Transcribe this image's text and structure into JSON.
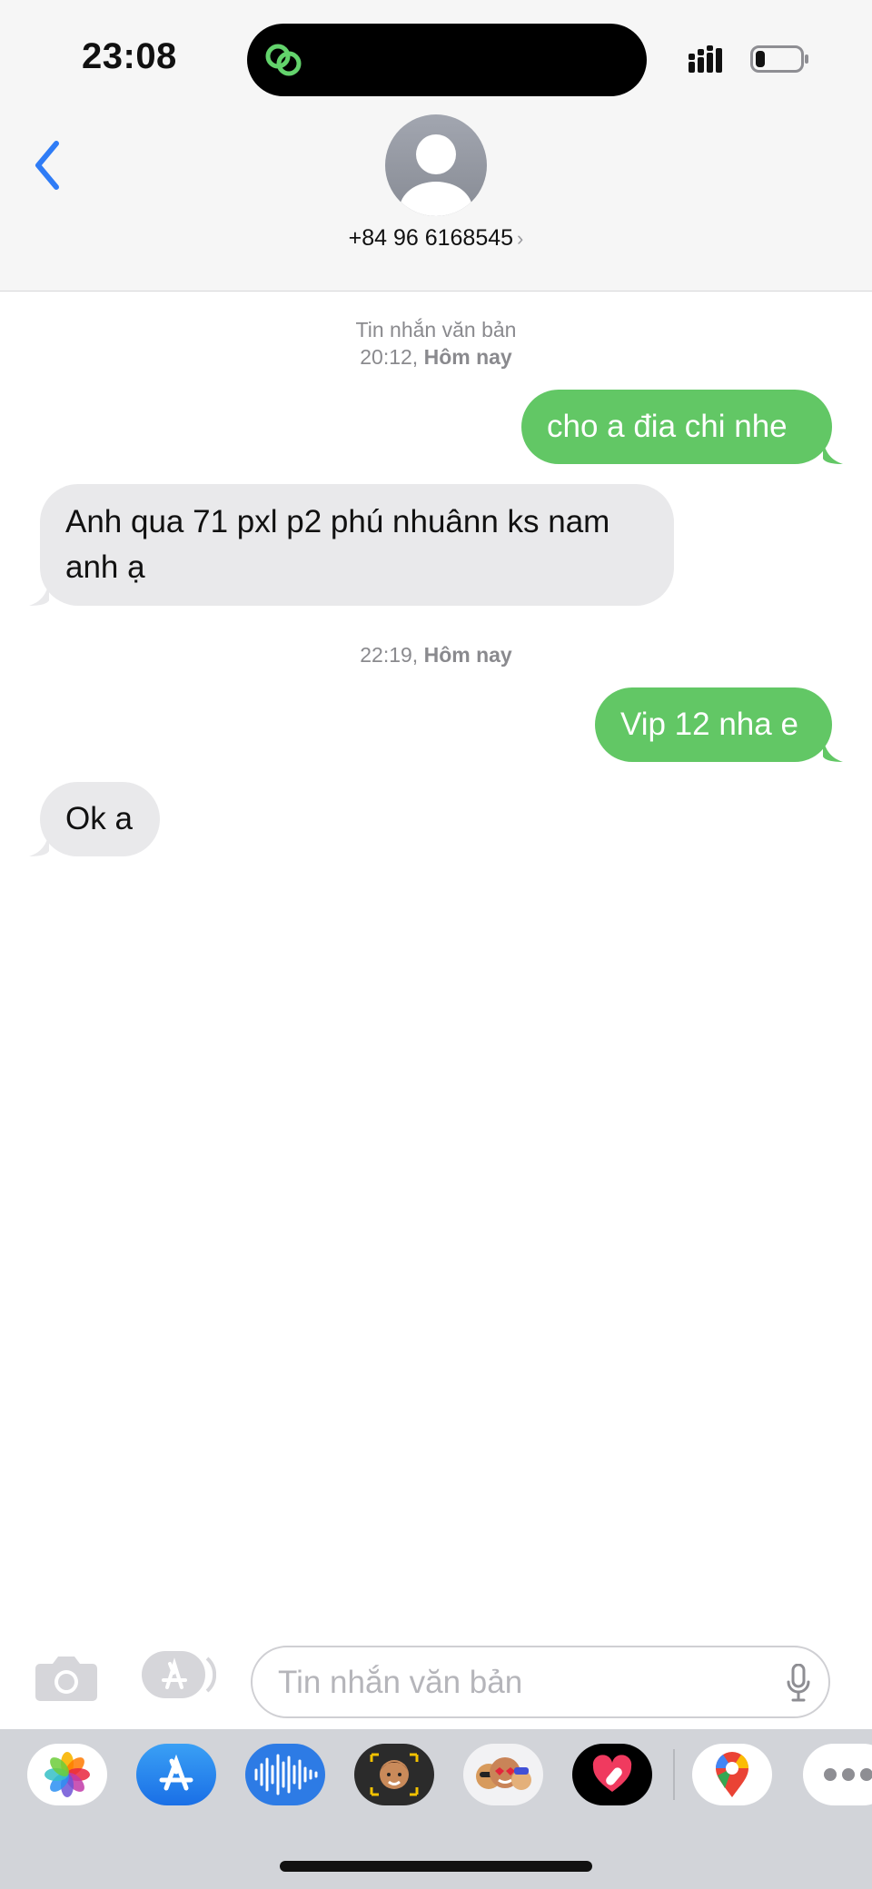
{
  "status_bar": {
    "time": "23:08",
    "activity_icon": "link-icon",
    "signal_icon": "signal-icon",
    "battery_icon": "battery-icon",
    "battery_level": 0.2
  },
  "header": {
    "back_icon": "chevron-left-icon",
    "avatar_icon": "person-icon",
    "contact_name": "+84 96 6168545",
    "contact_chevron": "›"
  },
  "thread": {
    "stamp1": {
      "label": "Tin nhắn văn bản",
      "time": "20:12,",
      "day": "Hôm nay"
    },
    "m1": "cho a đia chi nhe",
    "m2": "Anh qua 71 pxl p2 phú nhuânn ks nam anh ạ",
    "stamp2": {
      "time": "22:19,",
      "day": "Hôm nay"
    },
    "m3": "Vip 12 nha e",
    "m4": "Ok a"
  },
  "composer": {
    "camera_icon": "camera-icon",
    "apps_icon": "app-store-icon",
    "placeholder": "Tin nhắn văn bản",
    "mic_icon": "microphone-icon"
  },
  "app_tray": {
    "apps": [
      "photos-icon",
      "app-store-icon",
      "audio-message-icon",
      "memoji-icon",
      "stickers-icon",
      "digital-touch-icon",
      "maps-icon",
      "more-icon"
    ]
  },
  "colors": {
    "outgoing_bubble": "#62c765",
    "incoming_bubble": "#e9e9eb",
    "accent": "#2f7cf6"
  }
}
